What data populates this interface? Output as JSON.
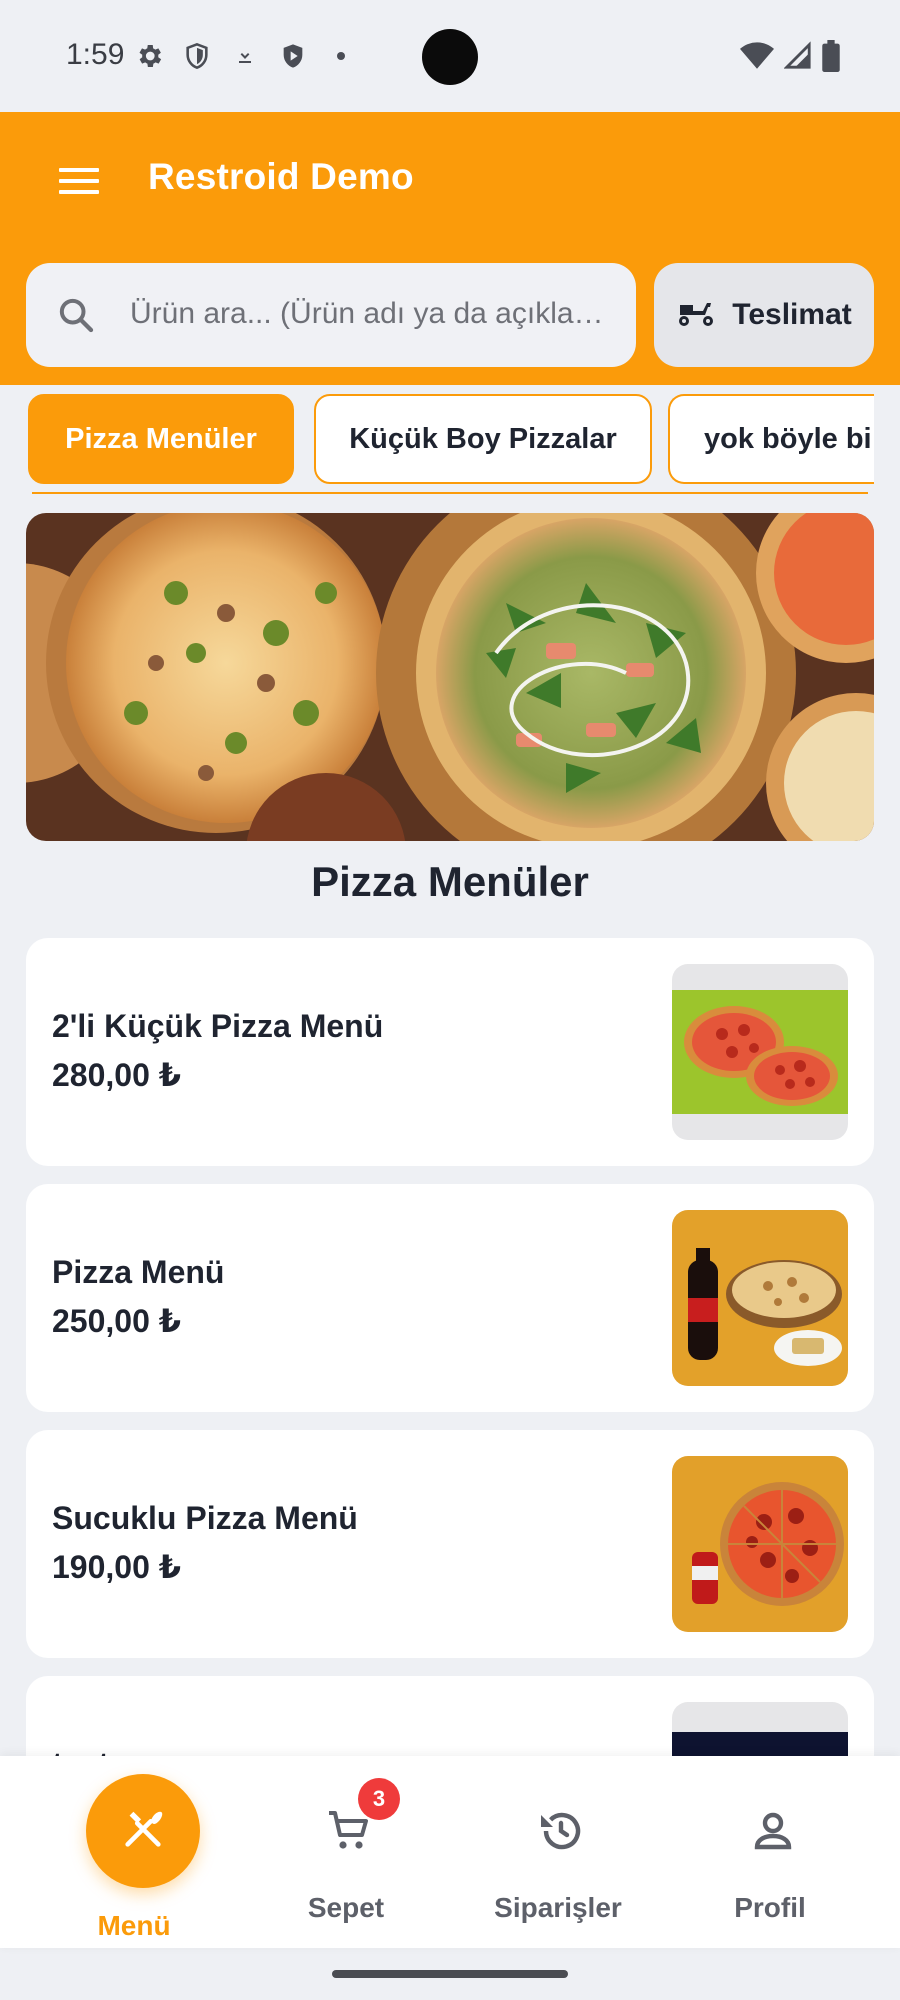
{
  "status_bar": {
    "time": "1:59",
    "left_icons": [
      "settings-icon",
      "shield-icon",
      "download-icon",
      "play-protect-icon",
      "dot-icon"
    ],
    "right_icons": [
      "wifi-icon",
      "signal-icon",
      "battery-icon"
    ]
  },
  "app_bar": {
    "title": "Restroid Demo",
    "menu_icon": "hamburger-menu-icon",
    "background": "#fb9b0a"
  },
  "search": {
    "placeholder": "Ürün ara... (Ürün adı ya da açıklaması)"
  },
  "delivery": {
    "label": "Teslimat",
    "icon": "scooter-icon"
  },
  "categories": [
    {
      "label": "Pizza Menüler",
      "active": true
    },
    {
      "label": "Küçük Boy Pizzalar",
      "active": false
    },
    {
      "label": "yok böyle bi",
      "active": false
    }
  ],
  "section": {
    "title": "Pizza Menüler"
  },
  "products": [
    {
      "name": "2'li Küçük Pizza Menü",
      "price": "280,00 ₺"
    },
    {
      "name": "Pizza Menü",
      "price": "250,00 ₺"
    },
    {
      "name": "Sucuklu Pizza Menü",
      "price": "190,00 ₺"
    },
    {
      "name": "test",
      "price": ""
    }
  ],
  "bottom_nav": [
    {
      "label": "Menü",
      "icon": "fork-knife-icon",
      "active": true
    },
    {
      "label": "Sepet",
      "icon": "cart-icon",
      "badge": "3",
      "active": false
    },
    {
      "label": "Siparişler",
      "icon": "history-icon",
      "active": false
    },
    {
      "label": "Profil",
      "icon": "person-icon",
      "active": false
    }
  ],
  "colors": {
    "accent": "#fb9b0a",
    "badge": "#ef3b3b",
    "background": "#eef0f4"
  }
}
